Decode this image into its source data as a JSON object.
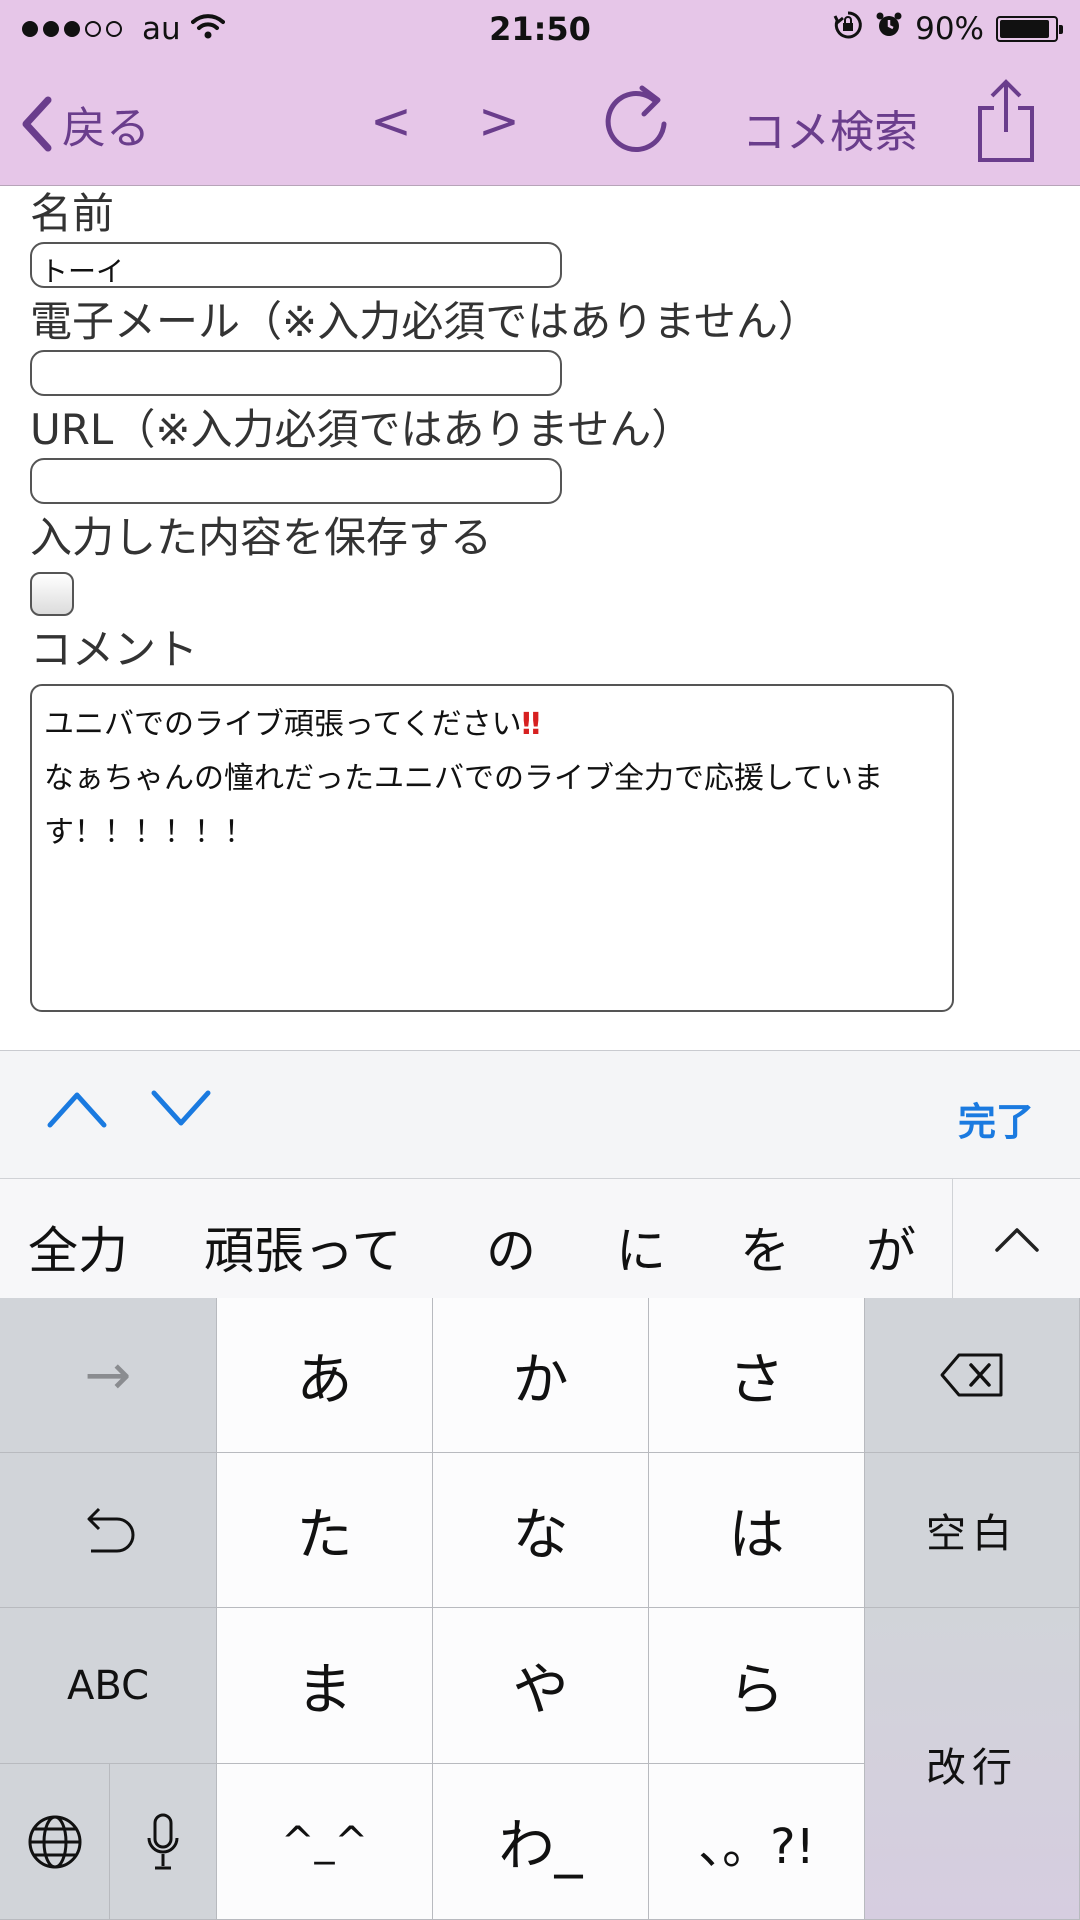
{
  "status_bar": {
    "carrier": "au",
    "time": "21:50",
    "battery_percent": "90%",
    "battery_level": 0.9,
    "icons": [
      "signal-dots",
      "wifi-icon",
      "rotation-lock-icon",
      "alarm-icon",
      "battery-icon"
    ]
  },
  "nav": {
    "back_label": "戻る",
    "prev_label": "<",
    "next_label": ">",
    "search_label": "コメ検索",
    "accent_color": "#6a3d8c",
    "bar_color": "#e6c6e8"
  },
  "form": {
    "name_label": "名前",
    "name_value": "トーイ",
    "email_label": "電子メール（※入力必須ではありません）",
    "email_value": "",
    "url_label": "URL（※入力必須ではありません）",
    "url_value": "",
    "save_label": "入力した内容を保存する",
    "save_checked": false,
    "comment_label": "コメント",
    "comment_line1": "ユニバでのライブ頑張ってください",
    "comment_line1_emoji": "‼",
    "comment_line2": "なぁちゃんの憧れだったユニバでのライブ全力で応援していま",
    "comment_line3": "す！！！！！！"
  },
  "accessory": {
    "done_label": "完了",
    "done_color": "#1a7ae0"
  },
  "candidates": [
    "全力",
    "頑張って",
    "の",
    "に",
    "を",
    "が"
  ],
  "keyboard": {
    "arrow": "→",
    "row1": [
      "あ",
      "か",
      "さ"
    ],
    "row2": [
      "た",
      "な",
      "は"
    ],
    "space_label": "空白",
    "abc_label": "ABC",
    "row3": [
      "ま",
      "や",
      "ら"
    ],
    "return_label": "改行",
    "kaomoji_label": "^_^",
    "wa_label": "わ_",
    "punct_label": "、。?!"
  }
}
